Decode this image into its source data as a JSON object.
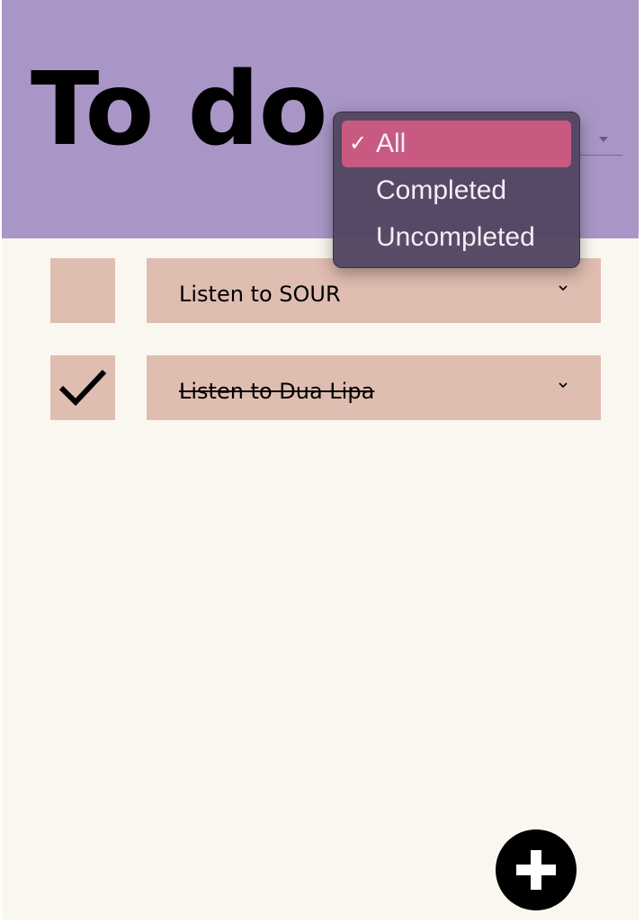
{
  "header": {
    "title": "To do",
    "filter": {
      "selected": "All",
      "options": [
        {
          "label": "All",
          "selected": true
        },
        {
          "label": "Completed",
          "selected": false
        },
        {
          "label": "Uncompleted",
          "selected": false
        }
      ]
    }
  },
  "todos": [
    {
      "text": "Listen to SOUR",
      "completed": false
    },
    {
      "text": "Listen to Dua Lipa",
      "completed": true
    }
  ],
  "icons": {
    "check": "checkmark-icon",
    "chevron": "chevron-down-icon",
    "add": "plus-icon",
    "option_selected": "checkmark-icon"
  },
  "colors": {
    "header_bg": "#a996c6",
    "page_bg": "#faf7f0",
    "item_bg": "#dfbdb0",
    "dropdown_bg": "#544662",
    "dropdown_selected": "#c85a82",
    "add_button": "#000000"
  },
  "dropdown_check_glyph": "✓"
}
